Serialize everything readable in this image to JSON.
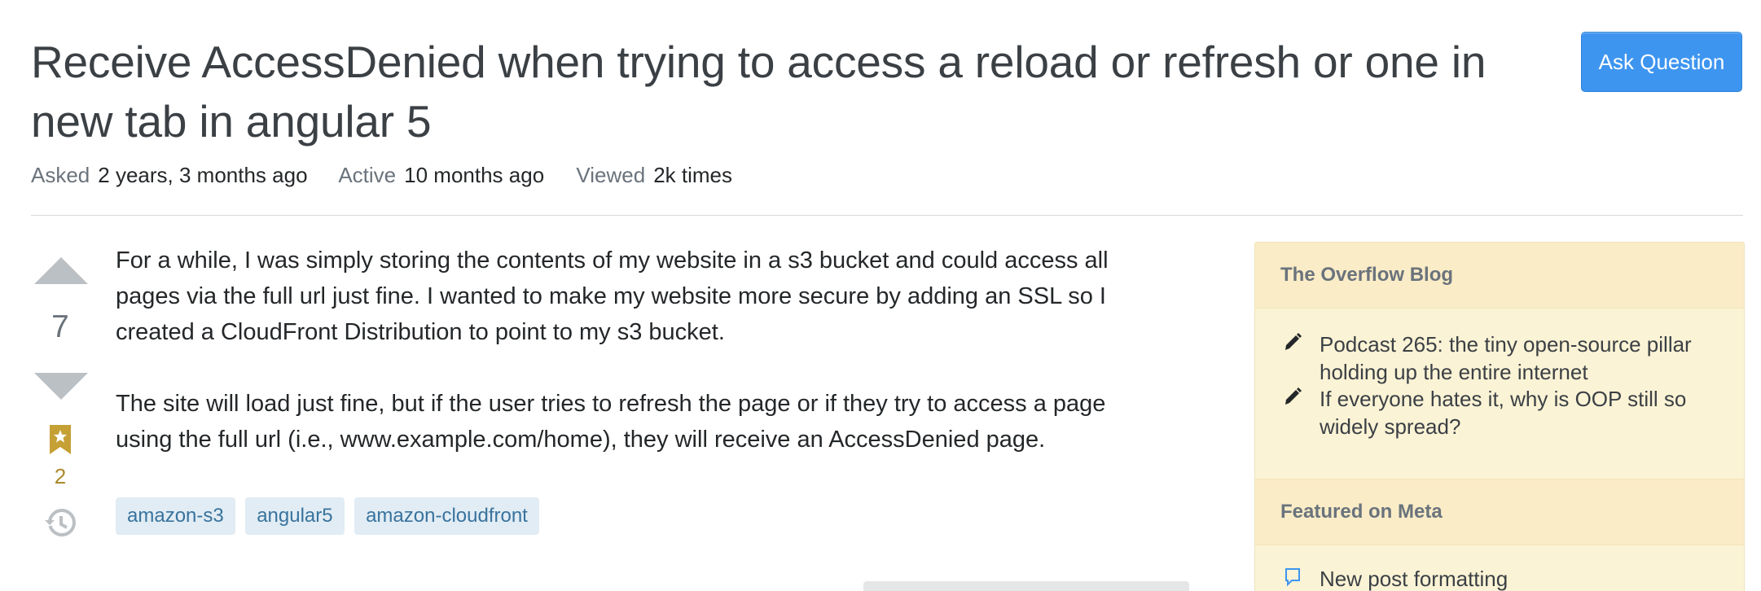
{
  "question": {
    "title": "Receive AccessDenied when trying to access a reload or refresh or one in new tab in angular 5",
    "ask_button": "Ask Question",
    "meta": [
      {
        "label": "Asked",
        "value": "2 years, 3 months ago"
      },
      {
        "label": "Active",
        "value": "10 months ago"
      },
      {
        "label": "Viewed",
        "value": "2k times"
      }
    ]
  },
  "votes": {
    "score": "7",
    "bookmark_count": "2",
    "icons": [
      "upvote-arrow-icon",
      "downvote-arrow-icon",
      "bookmark-star-icon",
      "history-icon"
    ]
  },
  "post": {
    "paragraphs": [
      "For a while, I was simply storing the contents of my website in a s3 bucket and could access all pages via the full url just fine. I wanted to make my website more secure by adding an SSL so I created a CloudFront Distribution to point to my s3 bucket.",
      "The site will load just fine, but if the user tries to refresh the page or if they try to access a page using the full url (i.e., www.example.com/home), they will receive an AccessDenied page."
    ],
    "tags": [
      "amazon-s3",
      "angular5",
      "amazon-cloudfront"
    ]
  },
  "sidebar": {
    "blog_heading": "The Overflow Blog",
    "blog_items": [
      {
        "icon": "pencil-icon",
        "text": "Podcast 265: the tiny open-source pillar holding up the entire internet"
      },
      {
        "icon": "pencil-icon",
        "text": "If everyone hates it, why is OOP still so widely spread?"
      }
    ],
    "meta_heading": "Featured on Meta",
    "meta_items": [
      {
        "icon": "speech-bubble-icon",
        "text": "New post formatting"
      }
    ]
  },
  "colors": {
    "accent": "#3d95f0",
    "tag_bg": "#e1ecf4",
    "tag_text": "#39739d",
    "sidebar_bg": "#fbf3d5",
    "bookmark": "#ab8b2d"
  }
}
